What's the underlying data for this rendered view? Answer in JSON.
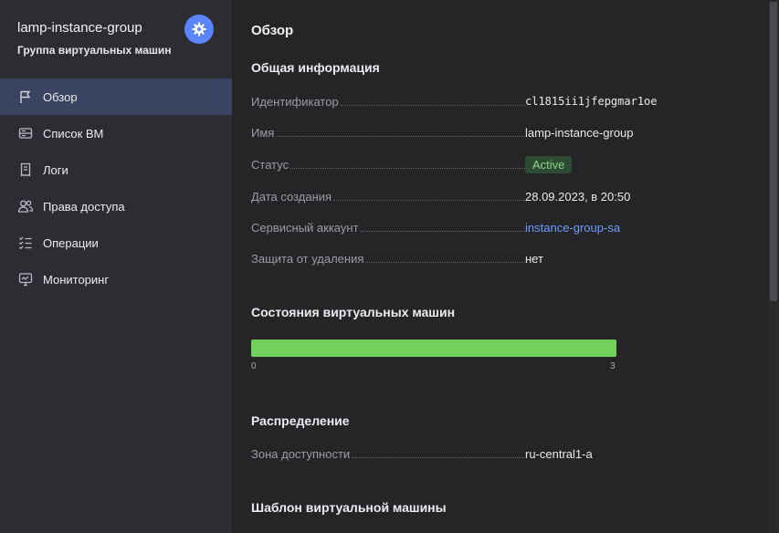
{
  "sidebar": {
    "title": "lamp-instance-group",
    "subtitle": "Группа виртуальных машин",
    "items": [
      {
        "label": "Обзор",
        "icon": "flag-icon",
        "active": true
      },
      {
        "label": "Список ВМ",
        "icon": "server-list-icon"
      },
      {
        "label": "Логи",
        "icon": "receipt-icon"
      },
      {
        "label": "Права доступа",
        "icon": "persons-icon"
      },
      {
        "label": "Операции",
        "icon": "checklist-icon"
      },
      {
        "label": "Мониторинг",
        "icon": "monitor-chart-icon"
      }
    ]
  },
  "main": {
    "title": "Обзор",
    "general": {
      "heading": "Общая информация",
      "rows": [
        {
          "label": "Идентификатор",
          "value": "cl1815ii1jfepgmar1oe"
        },
        {
          "label": "Имя",
          "value": "lamp-instance-group"
        },
        {
          "label": "Статус",
          "value": "Active"
        },
        {
          "label": "Дата создания",
          "value": "28.09.2023, в 20:50"
        },
        {
          "label": "Сервисный аккаунт",
          "value": "instance-group-sa"
        },
        {
          "label": "Защита от удаления",
          "value": "нет"
        }
      ]
    },
    "vm_states": {
      "heading": "Состояния виртуальных машин",
      "min": "0",
      "max": "3",
      "fill_fraction": 1.0
    },
    "distribution": {
      "heading": "Распределение",
      "rows": [
        {
          "label": "Зона доступности",
          "value": "ru-central1-a"
        }
      ]
    },
    "template": {
      "heading": "Шаблон виртуальной машины"
    }
  },
  "colors": {
    "accent": "#5b84ff",
    "active_bg": "#3a4361",
    "status_green": "#8ad48a",
    "progress_green": "#72d15a",
    "link": "#6f9bff"
  }
}
